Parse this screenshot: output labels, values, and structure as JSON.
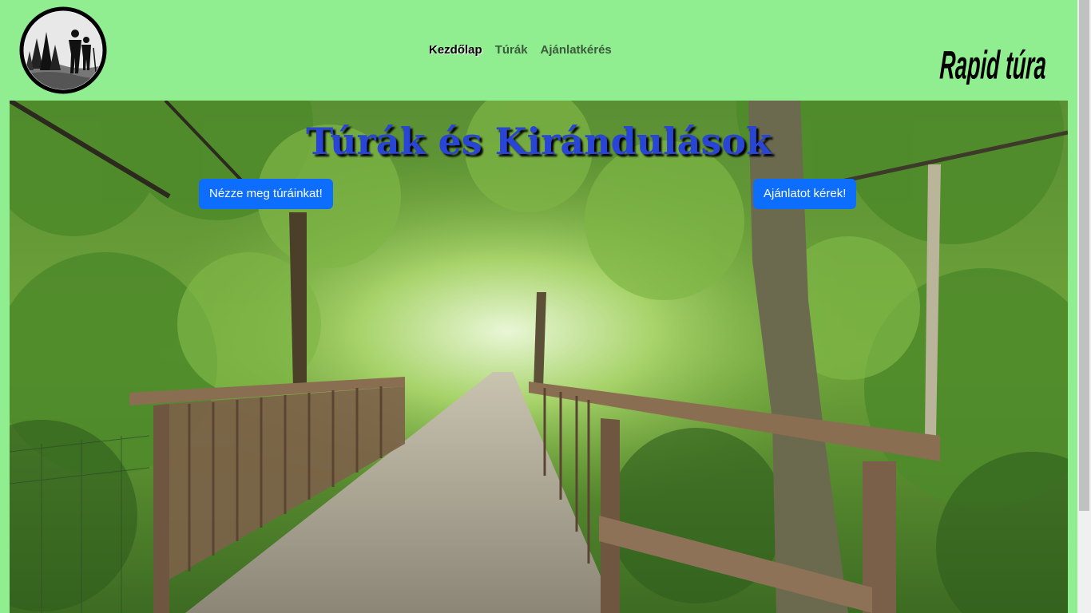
{
  "nav": {
    "items": [
      {
        "label": "Kezdőlap",
        "active": true
      },
      {
        "label": "Túrák",
        "active": false
      },
      {
        "label": "Ajánlatkérés",
        "active": false
      }
    ]
  },
  "brand": {
    "text": "Rapid túra"
  },
  "hero": {
    "title": "Túrák és Kirándulások",
    "tours_button": "Nézze meg túráinkat!",
    "offer_button": "Ajánlatot kérek!"
  },
  "colors": {
    "header_bg": "#90ee90",
    "button_bg": "#0d6efd",
    "title_color": "#2845d6"
  }
}
